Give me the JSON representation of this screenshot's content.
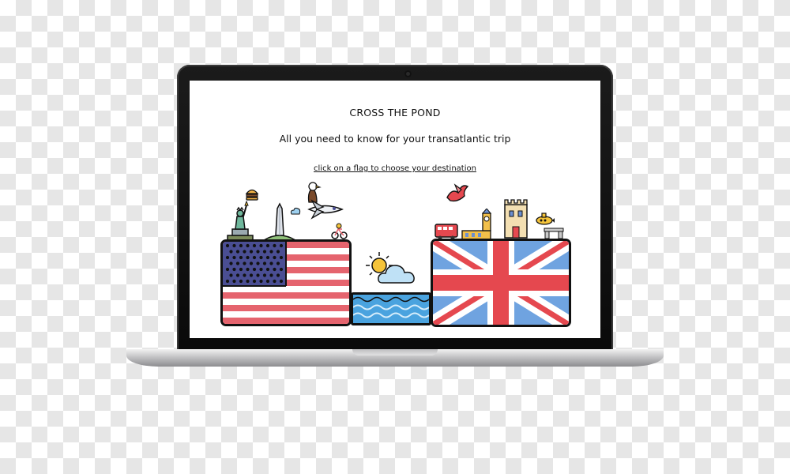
{
  "site": {
    "title": "CROSS THE POND",
    "tagline": "All you need to know for your transatlantic trip",
    "choose_link": "click on a flag to choose your destination"
  },
  "colors": {
    "usa_red": "#e5646e",
    "usa_blue": "#4a4e93",
    "uk_red": "#e5484f",
    "uk_blue": "#6fa3e0",
    "ocean_blue": "#4aa3df",
    "sun_yellow": "#f5c43a"
  },
  "icons": {
    "usa_landmarks": [
      "statue-of-liberty-icon",
      "washington-monument-icon",
      "eagle-icon",
      "space-shuttle-icon",
      "burger-icon",
      "bicycle-icon"
    ],
    "ocean": [
      "sun-icon",
      "cloud-icon",
      "waves-icon"
    ],
    "uk_landmarks": [
      "dragon-icon",
      "london-bus-icon",
      "big-ben-icon",
      "castle-icon",
      "submarine-icon",
      "stonehenge-icon"
    ]
  }
}
